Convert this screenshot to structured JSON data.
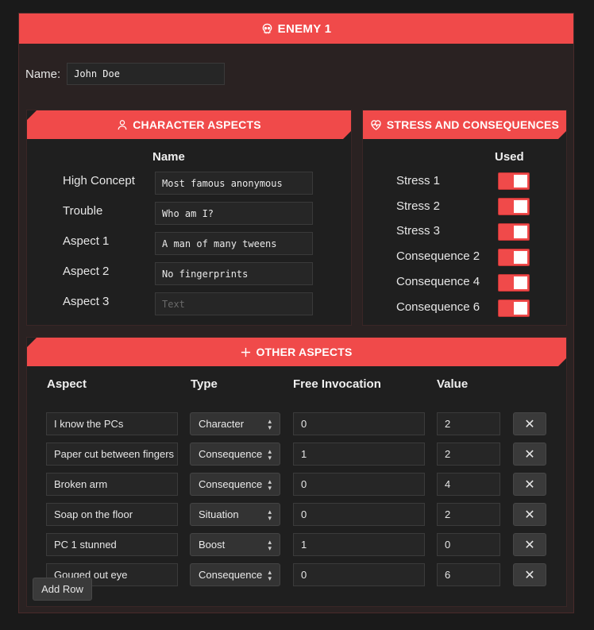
{
  "header": {
    "title": "ENEMY 1",
    "icon": "skull-icon"
  },
  "name_field": {
    "label": "Name:",
    "value": "John Doe"
  },
  "character_aspects": {
    "title": "CHARACTER ASPECTS",
    "icon": "user-icon",
    "column_header": "Name",
    "rows": [
      {
        "label": "High Concept",
        "value": "Most famous anonymous",
        "placeholder": ""
      },
      {
        "label": "Trouble",
        "value": "Who am I?",
        "placeholder": ""
      },
      {
        "label": "Aspect 1",
        "value": "A man of many tweens",
        "placeholder": ""
      },
      {
        "label": "Aspect 2",
        "value": "No fingerprints",
        "placeholder": ""
      },
      {
        "label": "Aspect 3",
        "value": "",
        "placeholder": "Text"
      }
    ]
  },
  "stress": {
    "title": "STRESS AND CONSEQUENCES",
    "icon": "heart-pulse-icon",
    "column_header": "Used",
    "rows": [
      {
        "label": "Stress 1",
        "on": true
      },
      {
        "label": "Stress 2",
        "on": true
      },
      {
        "label": "Stress 3",
        "on": true
      },
      {
        "label": "Consequence 2",
        "on": true
      },
      {
        "label": "Consequence 4",
        "on": true
      },
      {
        "label": "Consequence 6",
        "on": true
      }
    ]
  },
  "other_aspects": {
    "title": "OTHER ASPECTS",
    "icon": "plus-icon",
    "columns": [
      "Aspect",
      "Type",
      "Free Invocation",
      "Value"
    ],
    "rows": [
      {
        "aspect": "I know the PCs",
        "type": "Character",
        "free": "0",
        "value": "2"
      },
      {
        "aspect": "Paper cut between fingers",
        "type": "Consequence",
        "free": "1",
        "value": "2"
      },
      {
        "aspect": "Broken arm",
        "type": "Consequence",
        "free": "0",
        "value": "4"
      },
      {
        "aspect": "Soap on the floor",
        "type": "Situation",
        "free": "0",
        "value": "2"
      },
      {
        "aspect": "PC 1 stunned",
        "type": "Boost",
        "free": "1",
        "value": "0"
      },
      {
        "aspect": "Gouged out eye",
        "type": "Consequence",
        "free": "0",
        "value": "6"
      }
    ],
    "add_row_label": "Add Row"
  },
  "colors": {
    "accent": "#f04a4a",
    "background": "#1a1a1a",
    "card": "#2a2222"
  }
}
